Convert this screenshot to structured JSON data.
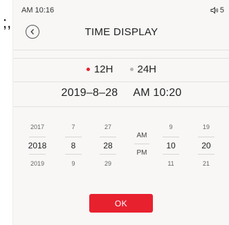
{
  "background_fragment": {
    "glyph": ";,"
  },
  "status_bar": {
    "time": "AM 10:16",
    "volume_level": "5",
    "volume_icon": "speaker-icon"
  },
  "header": {
    "back_icon": "chevron-left-icon",
    "title": "TIME DISPLAY"
  },
  "format_options": [
    {
      "label": "12H",
      "selected": true
    },
    {
      "label": "24H",
      "selected": false
    }
  ],
  "current": {
    "date": "2019–8–28",
    "time": "AM 10:20"
  },
  "pickers": {
    "year": {
      "prev": "2017",
      "value": "2018",
      "next": "2019"
    },
    "month": {
      "prev": "7",
      "value": "8",
      "next": "9"
    },
    "day": {
      "prev": "27",
      "value": "28",
      "next": "29"
    },
    "ampm": {
      "am": "AM",
      "pm": "PM"
    },
    "hour": {
      "prev": "9",
      "value": "10",
      "next": "11"
    },
    "minute": {
      "prev": "19",
      "value": "20",
      "next": "21"
    }
  },
  "ok_button": {
    "label": "OK"
  },
  "colors": {
    "accent": "#e8212f",
    "inactive_dot": "#b5b5b5",
    "screen_bg": "#f8f7f6"
  }
}
